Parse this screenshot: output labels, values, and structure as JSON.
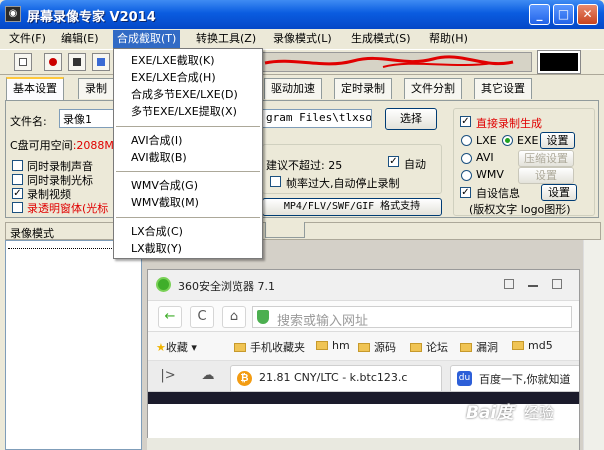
{
  "window": {
    "title": "屏幕录像专家 V2014",
    "icon_name": "camera-icon",
    "minimize": "_",
    "maximize": "□",
    "close": "✕"
  },
  "menu": {
    "items": [
      "文件(F)",
      "编辑(E)",
      "合成截取(T)",
      "转换工具(Z)",
      "录像模式(L)",
      "生成模式(S)",
      "帮助(H)"
    ]
  },
  "dropdown": {
    "items": [
      "EXE/LXE截取(K)",
      "EXE/LXE合成(H)",
      "合成多节EXE/LXE(D)",
      "多节EXE/LXE提取(X)",
      "AVI合成(I)",
      "AVI截取(B)",
      "WMV合成(G)",
      "WMV截取(M)",
      "LX合成(C)",
      "LX截取(Y)"
    ]
  },
  "tabs": [
    "基本设置",
    "录制",
    "驱动加速",
    "定时录制",
    "文件分割",
    "其它设置"
  ],
  "panel": {
    "filename_label": "文件名:",
    "filename_value": "录像1",
    "path_value": "gram Files\\tlxsof",
    "choose_button": "选择",
    "disk_label": "C盘可用空间",
    "disk_value": ":2088M",
    "suggest_text": "建议不超过:",
    "suggest_value": "25",
    "auto_label": "自动",
    "framerate_text": "帧率过大,自动停止录制",
    "format_text": "MP4/FLV/SWF/GIF",
    "format_support": "格式支持",
    "cb_sound": "同时录制声音",
    "cb_cursor": "同时录制光标",
    "cb_video": "录制视频",
    "cb_transparent": "录透明窗体(光标",
    "direct_gen": "直接录制生成",
    "lxe_label": "LXE",
    "exe_label": "EXE",
    "avi_label": "AVI",
    "wmv_label": "WMV",
    "settings_button": "设置",
    "compress_button": "压缩设置",
    "settings_button2": "设置",
    "settings_button3": "设置",
    "selfinfo_label": "自设信息",
    "settings_button4": "设置",
    "copyright_text": "(版权文字 logo图形)"
  },
  "mode": {
    "header": "录像模式"
  },
  "browser": {
    "title": "360安全浏览器 7.1",
    "address_placeholder": "搜索或输入网址",
    "nav_back": "←",
    "nav_refresh": "C",
    "nav_home": "⌂",
    "bookmarks_label": "收藏",
    "bookmarks": [
      "手机收藏夹",
      "hm",
      "源码",
      "论坛",
      "漏洞",
      "md5"
    ],
    "tab1": "21.81 CNY/LTC - k.btc123.c",
    "tab2": "百度一下,你就知道"
  },
  "watermark": {
    "text": "Bai度",
    "suffix": "经验"
  },
  "colors": {
    "title_blue": "#0a5ce0",
    "menu_highlight": "#316ac5",
    "red_text": "#e00000",
    "scribble_red": "#e00000"
  }
}
